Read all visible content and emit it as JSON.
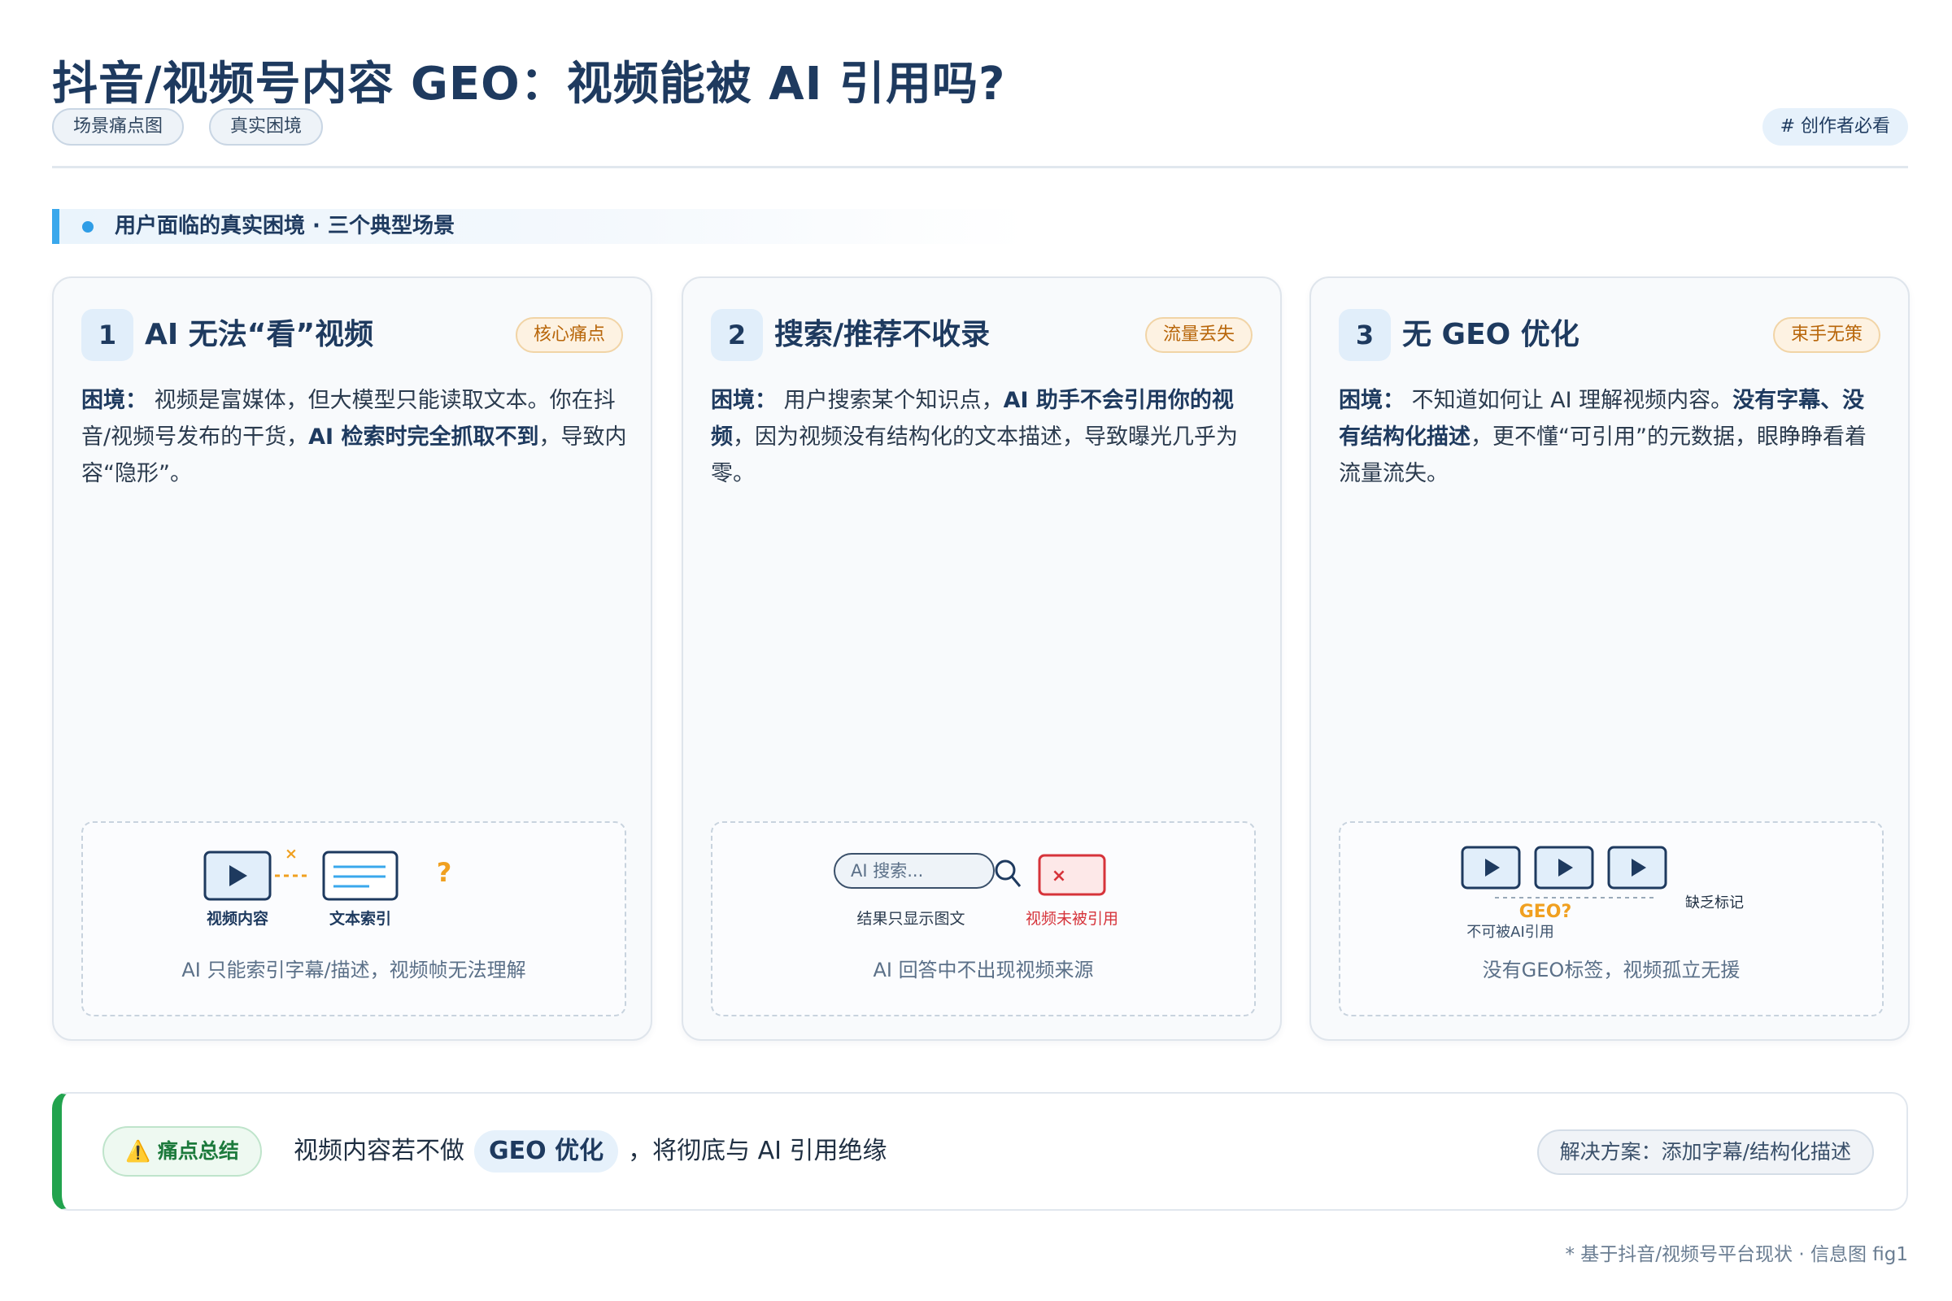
{
  "header": {
    "title": "抖音/视频号内容 GEO：视频能被 AI 引用吗?",
    "tags": [
      "场景痛点图",
      "真实困境"
    ],
    "right_tag": "# 创作者必看"
  },
  "section": {
    "heading": "用户面临的真实困境 · 三个典型场景"
  },
  "cards": [
    {
      "num": "1",
      "title": "AI 无法“看”视频",
      "badge": "核心痛点",
      "desc": [
        {
          "t": "困境：",
          "b": true
        },
        {
          "t": " 视频是富媒体，但大模型只能读取文本。你在抖音/视频号发布的干货，",
          "b": false
        },
        {
          "t": "AI 检索时完全抓取不到",
          "b": true
        },
        {
          "t": "，导致内容“隐形”。",
          "b": false
        }
      ],
      "illus": {
        "left_label": "视频内容",
        "right_label": "文本索引",
        "cross": "×",
        "question": "?",
        "caption": "AI 只能索引字幕/描述，视频帧无法理解"
      }
    },
    {
      "num": "2",
      "title": "搜索/推荐不收录",
      "badge": "流量丢失",
      "desc": [
        {
          "t": "困境：",
          "b": true
        },
        {
          "t": " 用户搜索某个知识点，",
          "b": false
        },
        {
          "t": "AI 助手不会引用你的视频",
          "b": true
        },
        {
          "t": "，因为视频没有结构化的文本描述，导致曝光几乎为零。",
          "b": false
        }
      ],
      "illus": {
        "search_placeholder": "AI 搜索...",
        "left_label": "结果只显示图文",
        "right_label": "视频未被引用",
        "cross": "×",
        "caption": "AI 回答中不出现视频来源"
      }
    },
    {
      "num": "3",
      "title": "无 GEO 优化",
      "badge": "束手无策",
      "desc": [
        {
          "t": "困境：",
          "b": true
        },
        {
          "t": " 不知道如何让 AI 理解视频内容。",
          "b": false
        },
        {
          "t": "没有字幕、没有结构化描述",
          "b": true
        },
        {
          "t": "，更不懂“可引用”的元数据，眼睁睁看着流量流失。",
          "b": false
        }
      ],
      "illus": {
        "geo_label": "GEO?",
        "right_label": "缺乏标记",
        "bottom_label": "不可被AI引用",
        "caption": "没有GEO标签，视频孤立无援"
      }
    }
  ],
  "summary": {
    "badge": "⚠️ 痛点总结",
    "text_before": "视频内容若不做",
    "highlight": "GEO 优化",
    "text_after": "，将彻底与 AI 引用绝缘",
    "right": "解决方案：添加字幕/结构化描述"
  },
  "footnote": "* 基于抖音/视频号平台现状 · 信息图 fig1",
  "colors": {
    "accent_blue": "#3aa8ec",
    "title_navy": "#1e3a5f",
    "warning_orange": "#f0a020",
    "error_red": "#d6333a",
    "success_green": "#22a34e"
  }
}
